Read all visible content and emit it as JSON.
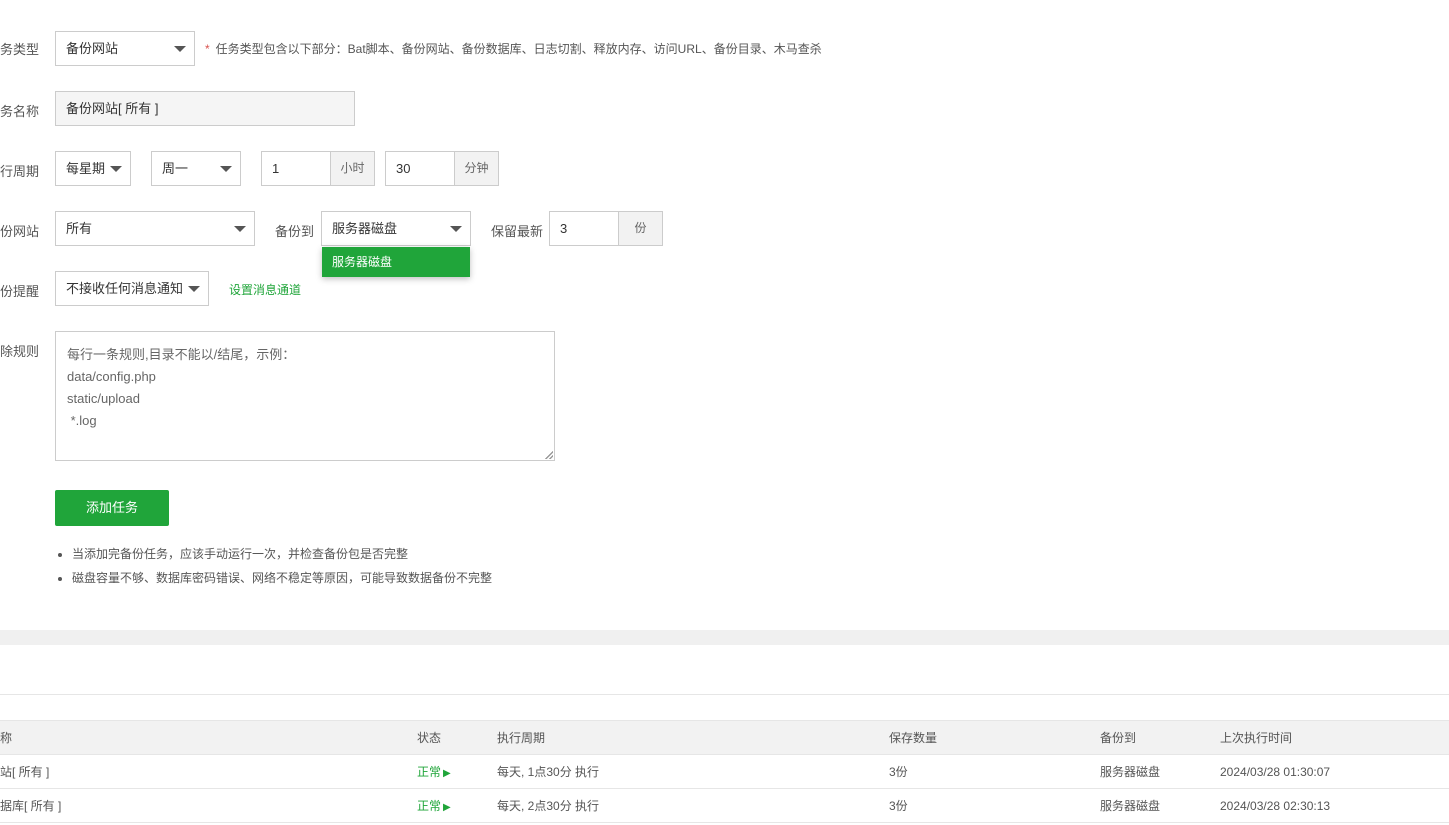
{
  "form": {
    "task_type": {
      "label": "务类型",
      "value": "备份网站",
      "hint_star": "*",
      "hint": "任务类型包含以下部分：Bat脚本、备份网站、备份数据库、日志切割、释放内存、访问URL、备份目录、木马查杀"
    },
    "task_name": {
      "label": "务名称",
      "value": "备份网站[ 所有 ]"
    },
    "period": {
      "label": "行周期",
      "freq": "每星期",
      "weekday": "周一",
      "hour": "1",
      "hour_unit": "小时",
      "minute": "30",
      "minute_unit": "分钟"
    },
    "site": {
      "label": "份网站",
      "value": "所有",
      "backup_to_label": "备份到",
      "backup_to_value": "服务器磁盘",
      "dropdown_option": "服务器磁盘",
      "keep_label": "保留最新",
      "keep_value": "3",
      "keep_unit": "份"
    },
    "notify": {
      "label": "份提醒",
      "value": "不接收任何消息通知",
      "link": "设置消息通道"
    },
    "exclude": {
      "label": "除规则",
      "placeholder_lines": [
        "每行一条规则,目录不能以/结尾，示例：",
        "data/config.php",
        "static/upload",
        " *.log"
      ]
    },
    "submit_label": "添加任务",
    "notes": [
      "当添加完备份任务，应该手动运行一次，并检查备份包是否完整",
      "磁盘容量不够、数据库密码错误、网络不稳定等原因，可能导致数据备份不完整"
    ]
  },
  "table": {
    "headers": [
      "称",
      "状态",
      "执行周期",
      "保存数量",
      "备份到",
      "上次执行时间"
    ],
    "rows": [
      {
        "name": "站[ 所有 ]",
        "status": "正常",
        "status_icon": "play-icon",
        "period": "每天, 1点30分 执行",
        "count": "3份",
        "target": "服务器磁盘",
        "last_run": "2024/03/28 01:30:07"
      },
      {
        "name": "据库[ 所有 ]",
        "status": "正常",
        "status_icon": "play-icon",
        "period": "每天, 2点30分 执行",
        "count": "3份",
        "target": "服务器磁盘",
        "last_run": "2024/03/28 02:30:13"
      }
    ]
  },
  "colors": {
    "accent": "#20a53a",
    "required": "#d9534f"
  }
}
